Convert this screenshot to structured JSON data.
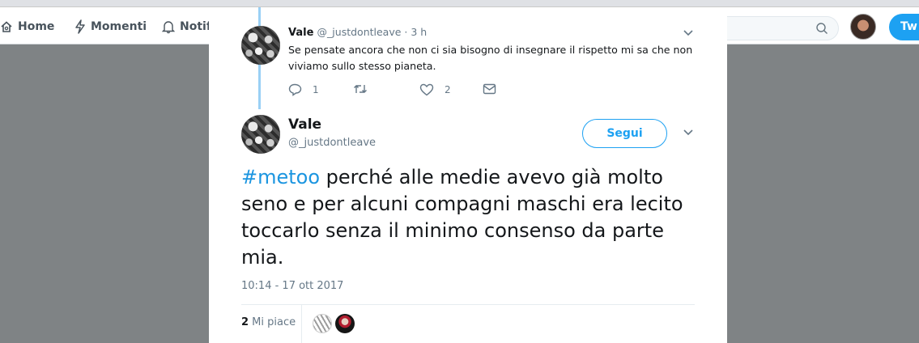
{
  "nav": {
    "home": "Home",
    "moments": "Momenti",
    "notifications": "Notifi",
    "tweet_button": "Tw"
  },
  "reply": {
    "name": "Vale",
    "meta": "@_justdontleave · 3 h",
    "text": "Se pensate ancora che non ci sia bisogno di insegnare il rispetto mi sa che non viviamo sullo stesso pianeta.",
    "reply_count": "1",
    "retweet_count": "",
    "like_count": "2"
  },
  "tweet": {
    "name": "Vale",
    "handle": "@_justdontleave",
    "follow_label": "Segui",
    "hashtag": "#metoo",
    "text": " perché alle medie avevo già molto seno e per alcuni compagni maschi era lecito toccarlo senza il minimo consenso da parte mia.",
    "timestamp": "10:14 - 17 ott 2017",
    "likes_number": "2",
    "likes_label": " Mi piace"
  },
  "colors": {
    "accent": "#1da1f2",
    "hashtag": "#1b95e0",
    "text": "#14171a",
    "muted": "#657786",
    "thread_line": "#9ad0f5"
  },
  "icons": [
    "home-icon",
    "lightning-icon",
    "bell-icon",
    "search-icon",
    "chevron-down-icon",
    "reply-icon",
    "retweet-icon",
    "heart-icon",
    "envelope-icon"
  ]
}
